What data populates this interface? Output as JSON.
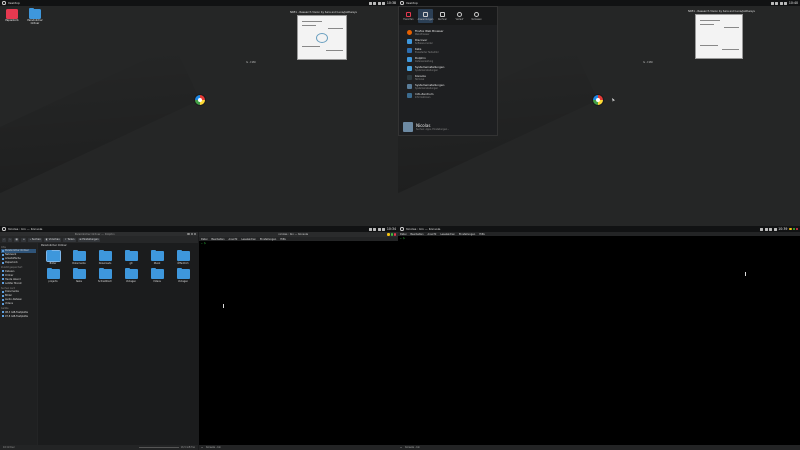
{
  "quad1": {
    "topbar": {
      "title": "Desktop",
      "time": "10:38"
    },
    "desktop_icons": [
      {
        "label": "Papierkorb",
        "color": "#e53950"
      },
      {
        "label": "Persönlicher Ordner",
        "color": "#3e97dc"
      }
    ],
    "wallpaper": {
      "caption": "NKE1 - Research Vision by Sara and Luna/pathways",
      "small_label": "ts - 1980"
    }
  },
  "quad2": {
    "topbar": {
      "title": "Desktop",
      "time": "10:40"
    },
    "wallpaper": {
      "caption": "NKE1 - Research Vision by Sara and Luna/pathways",
      "small_label": "ts - 1980"
    },
    "launcher": {
      "tabs": [
        {
          "label": "Favoriten",
          "icon": "bookmark-icon"
        },
        {
          "label": "Anwendungen",
          "icon": "grid-icon"
        },
        {
          "label": "Rechner",
          "icon": "monitor-icon"
        },
        {
          "label": "Verlauf",
          "icon": "clock-icon"
        },
        {
          "label": "Verlassen",
          "icon": "power-icon"
        }
      ],
      "apps": [
        {
          "name": "Firefox Web Browser",
          "desc": "Web-Browser",
          "color": "#e66000"
        },
        {
          "name": "Discover",
          "desc": "Software-Center",
          "color": "#3e97dc"
        },
        {
          "name": "Kate",
          "desc": "Erweiterter Texteditor",
          "color": "#2c6db0"
        },
        {
          "name": "Dolphin",
          "desc": "Dateiverwaltung",
          "color": "#3e97dc"
        },
        {
          "name": "Systemeinstellungen",
          "desc": "Systemeinstellungen",
          "color": "#4aa3df"
        },
        {
          "name": "Konsole",
          "desc": "Terminal",
          "color": "#2d3a40"
        },
        {
          "name": "Systemeinstellungen",
          "desc": "Systemeinstellungen",
          "color": "#5a7d9a"
        },
        {
          "name": "Info-Zentrum",
          "desc": "Informationen",
          "color": "#3b6b8f"
        }
      ],
      "user": {
        "name": "Nicolas",
        "desc": "Suchen: Apps, Einstellungen..."
      }
    }
  },
  "quad3": {
    "topbar": {
      "title": "Nicolas : bin — Konsole",
      "time": "10:34"
    },
    "filemanager": {
      "title": "Persönlicher Ordner — Dolphin",
      "toolbar": [
        "Suchen",
        "Vorschau",
        "Teilen",
        "Einstellungen"
      ],
      "sidebar": {
        "groups": [
          {
            "title": "Orte",
            "items": [
              "Persönlicher Ordner",
              "Netzwerk",
              "Arbeitsfläche",
              "Papierkorb"
            ]
          },
          {
            "title": "Zuletzt gespeichert",
            "items": [
              "Dateien",
              "Ordner",
              "Heute Abend",
              "Letzter Monat"
            ]
          },
          {
            "title": "Suchen nach",
            "items": [
              "Dokumente",
              "Bilder",
              "Audio-Dateien",
              "Videos"
            ]
          },
          {
            "title": "Geräte",
            "items": [
              "98,3 GiB-Festplatte",
              "97,8 GiB-Festplatte"
            ]
          }
        ]
      },
      "crumb": "Persönlicher Ordner",
      "files": [
        "Bilder",
        "Dokumente",
        "Downloads",
        "git",
        "Musik",
        "Öffentlich",
        "projects",
        "tasks",
        "Schreibtisch",
        "Vorlagen",
        "Videos",
        "Vorlagen"
      ],
      "status_left": "10 Ordner",
      "status_right": "16,5 GiB frei"
    },
    "konsole": {
      "title": "nicolas : bin — Konsole",
      "menu": [
        "Datei",
        "Bearbeiten",
        "Ansicht",
        "Lesezeichen",
        "Einstellungen",
        "Hilfe"
      ],
      "prompt": "~ $",
      "status": "Konsole - bin"
    }
  },
  "quad4": {
    "topbar": {
      "title": "Nicolas : bin — Konsole",
      "time": "10:39"
    },
    "konsole": {
      "menu": [
        "Datei",
        "Bearbeiten",
        "Ansicht",
        "Lesezeichen",
        "Einstellungen",
        "Hilfe"
      ],
      "prompt": "~ $",
      "status": "Konsole - bin"
    }
  }
}
